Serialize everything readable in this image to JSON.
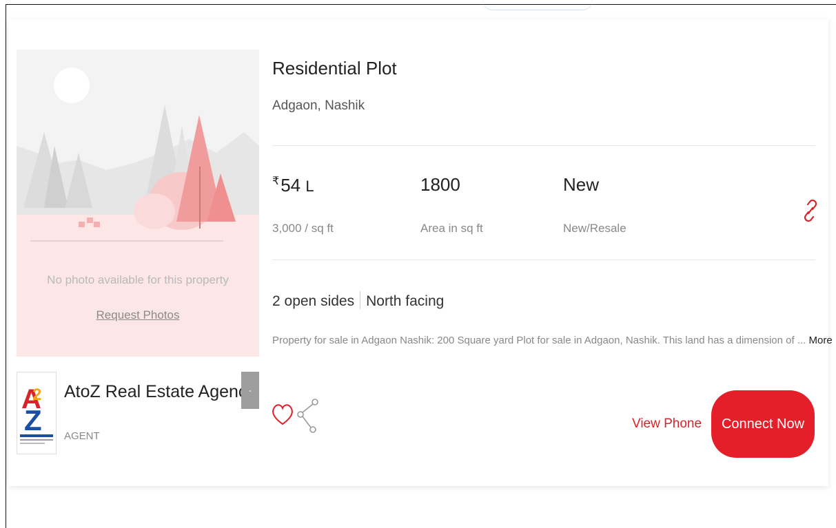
{
  "listing": {
    "title": "Residential Plot",
    "location": "Adgaon, Nashik",
    "price": {
      "symbol": "₹",
      "value": "54",
      "unit": "L",
      "label": "3,000 / sq ft"
    },
    "area": {
      "value": "1800",
      "label": "Area in sq ft"
    },
    "condition": {
      "value": "New",
      "label": "New/Resale"
    },
    "features": [
      "2 open sides",
      "North facing"
    ],
    "description": "Property for sale in Adgaon Nashik: 200 Square yard Plot for sale in Adgaon, Nashik. This land has a dimension of ...",
    "more_label": "More"
  },
  "photo": {
    "note": "No photo available for this property",
    "request_label": "Request Photos"
  },
  "agent": {
    "name": "AtoZ Real Estate Agency",
    "role": "AGENT",
    "badge": "-"
  },
  "actions": {
    "view_phone": "View Phone",
    "connect": "Connect Now"
  },
  "icons": {
    "link": "link-icon",
    "heart": "heart-icon",
    "share": "share-icon"
  },
  "colors": {
    "accent": "#e51f2a",
    "muted": "#888888"
  }
}
